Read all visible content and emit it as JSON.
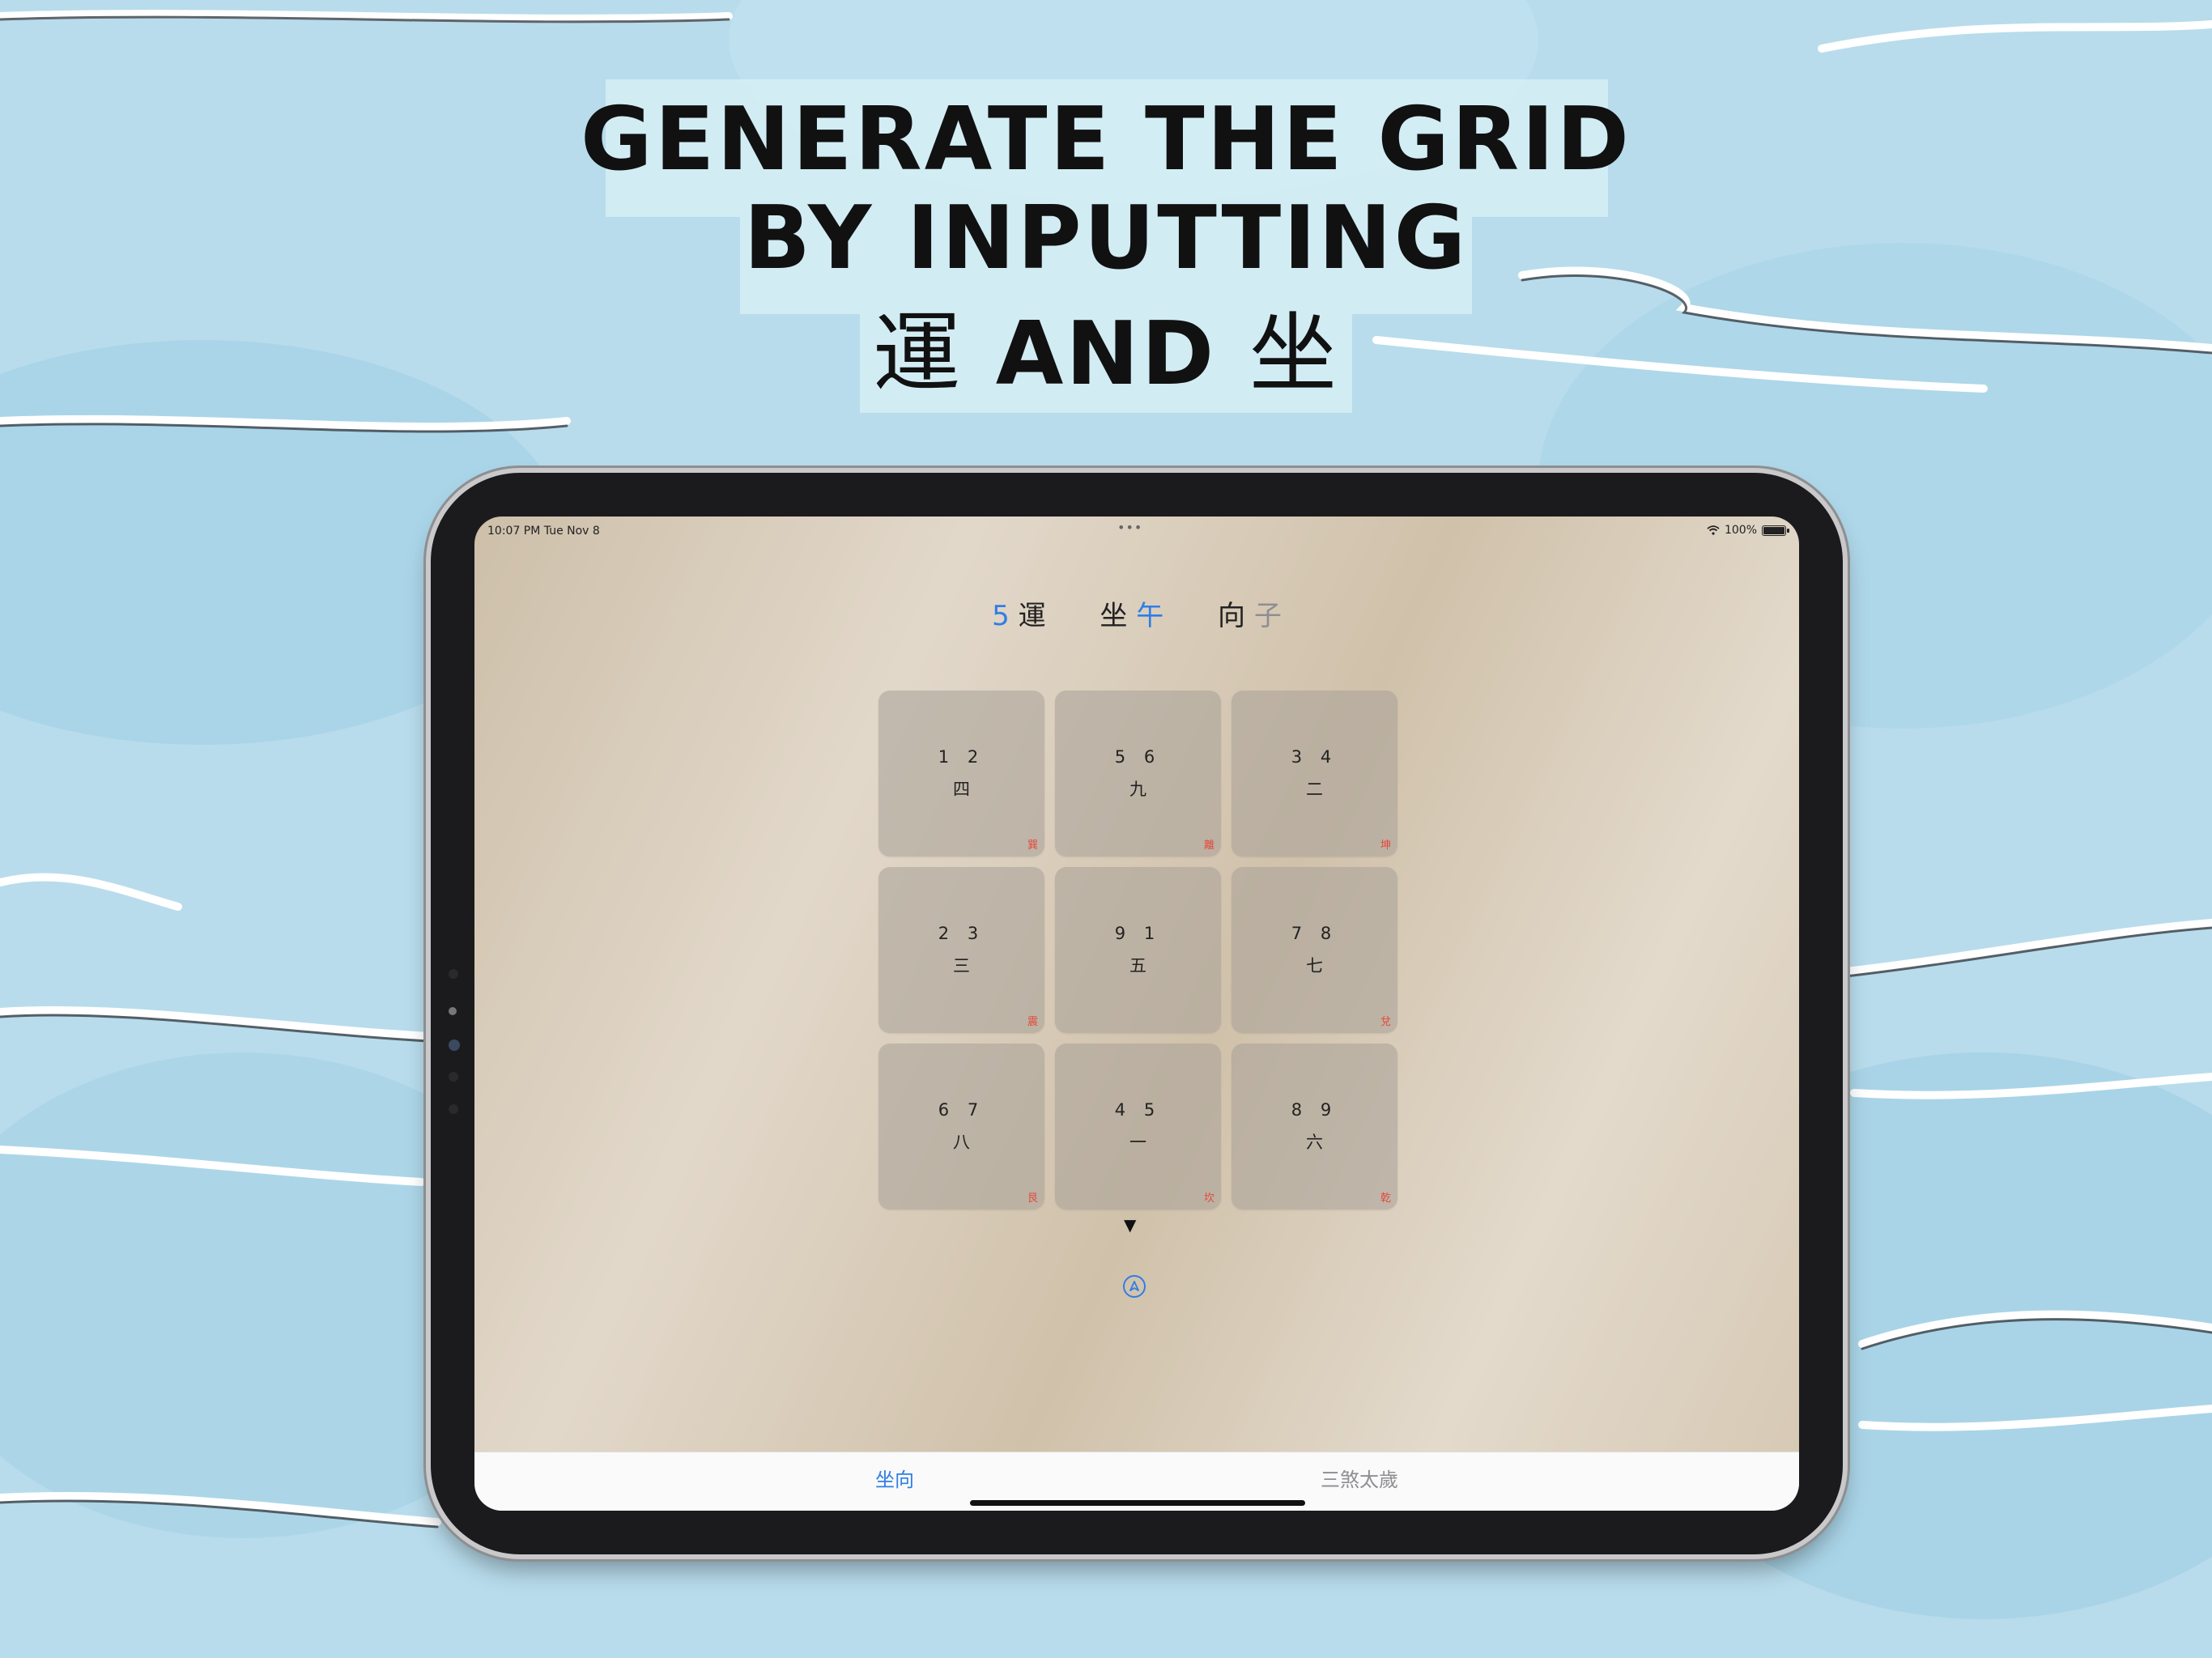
{
  "headline": {
    "line1": "GENERATE THE GRID",
    "line2": "BY INPUTTING",
    "line3_cjk_a": "運",
    "line3_word": "AND",
    "line3_cjk_b": "坐"
  },
  "status_bar": {
    "time": "10:07 PM  Tue Nov 8",
    "dots": "•••",
    "battery_pct": "100%",
    "icons": [
      "wifi-icon",
      "battery-icon"
    ]
  },
  "header": {
    "period_value": "5",
    "period_label": "運",
    "sitting_label": "坐",
    "sitting_value": "午",
    "facing_label": "向",
    "facing_value": "子"
  },
  "grid": [
    {
      "nums": "1 2",
      "star": "四",
      "trigram": "巽"
    },
    {
      "nums": "5 6",
      "star": "九",
      "trigram": "離"
    },
    {
      "nums": "3 4",
      "star": "二",
      "trigram": "坤"
    },
    {
      "nums": "2 3",
      "star": "三",
      "trigram": "震"
    },
    {
      "nums": "9 1",
      "star": "五",
      "trigram": ""
    },
    {
      "nums": "7 8",
      "star": "七",
      "trigram": "兌"
    },
    {
      "nums": "6 7",
      "star": "八",
      "trigram": "艮"
    },
    {
      "nums": "4 5",
      "star": "一",
      "trigram": "坎"
    },
    {
      "nums": "8 9",
      "star": "六",
      "trigram": "乾"
    }
  ],
  "arrow": "▼",
  "compass_icon": "location-arrow-icon",
  "tabs": [
    {
      "label": "坐向",
      "selected": true
    },
    {
      "label": "三煞太歲",
      "selected": false
    }
  ],
  "colors": {
    "accent": "#2f7ee6",
    "trigram": "#e5483b",
    "background": "#b8dcec"
  }
}
